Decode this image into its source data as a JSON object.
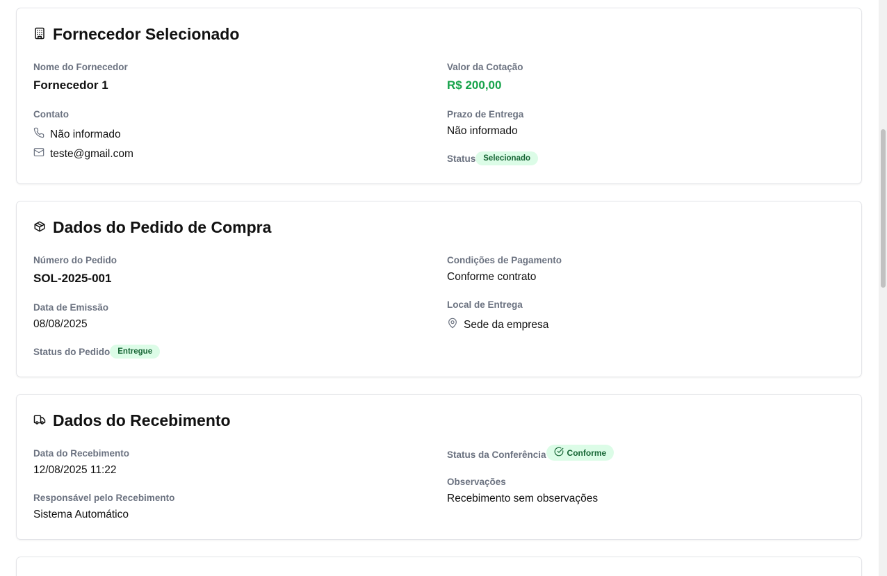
{
  "supplier": {
    "title": "Fornecedor Selecionado",
    "icon": "building-icon",
    "name_label": "Nome do Fornecedor",
    "name_value": "Fornecedor 1",
    "contact_label": "Contato",
    "phone_value": "Não informado",
    "email_value": "teste@gmail.com",
    "quote_label": "Valor da Cotação",
    "quote_value": "R$ 200,00",
    "delivery_label": "Prazo de Entrega",
    "delivery_value": "Não informado",
    "status_label": "Status",
    "status_value": "Selecionado"
  },
  "order": {
    "title": "Dados do Pedido de Compra",
    "icon": "package-icon",
    "number_label": "Número do Pedido",
    "number_value": "SOL-2025-001",
    "issue_label": "Data de Emissão",
    "issue_value": "08/08/2025",
    "status_label": "Status do Pedido",
    "status_value": "Entregue",
    "payment_label": "Condições de Pagamento",
    "payment_value": "Conforme contrato",
    "location_label": "Local de Entrega",
    "location_value": "Sede da empresa"
  },
  "receipt": {
    "title": "Dados do Recebimento",
    "icon": "truck-icon",
    "date_label": "Data do Recebimento",
    "date_value": "12/08/2025 11:22",
    "responsible_label": "Responsável pelo Recebimento",
    "responsible_value": "Sistema Automático",
    "check_label": "Status da Conferência",
    "check_value": "Conforme",
    "notes_label": "Observações",
    "notes_value": "Recebimento sem observações"
  },
  "colors": {
    "accent_green": "#16a34a",
    "badge_bg": "#dcfce7",
    "badge_text": "#166534",
    "label_gray": "#6b7280"
  }
}
